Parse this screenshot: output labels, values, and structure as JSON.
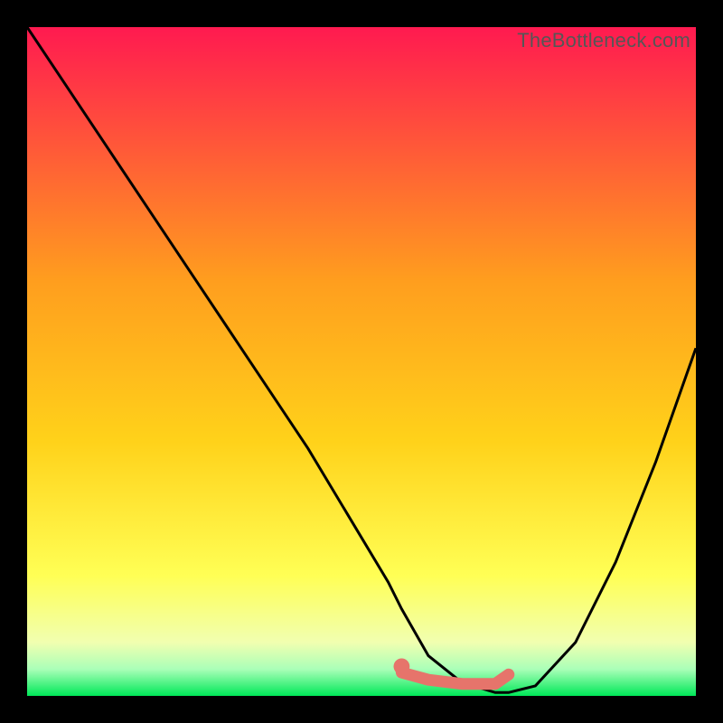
{
  "watermark": {
    "text": "TheBottleneck.com"
  },
  "colors": {
    "gradient_top": "#ff1a50",
    "gradient_mid": "#ffd21a",
    "gradient_low": "#ffff8a",
    "gradient_base": "#00e858",
    "curve": "#000000",
    "marker": "#e6746b",
    "frame": "#000000"
  },
  "chart_data": {
    "type": "line",
    "title": "",
    "xlabel": "",
    "ylabel": "",
    "xlim": [
      0,
      100
    ],
    "ylim": [
      0,
      100
    ],
    "grid": false,
    "legend": false,
    "series": [
      {
        "name": "curve",
        "x": [
          0,
          6,
          12,
          18,
          24,
          30,
          36,
          42,
          48,
          54,
          56,
          60,
          65,
          70,
          72,
          76,
          82,
          88,
          94,
          100
        ],
        "y": [
          100,
          91,
          82,
          73,
          64,
          55,
          46,
          37,
          27,
          17,
          13,
          6,
          2,
          0.5,
          0.5,
          1.5,
          8,
          20,
          35,
          52
        ]
      }
    ],
    "marker_segment": {
      "x": [
        56,
        60,
        65,
        70,
        72
      ],
      "y": [
        3.5,
        2.4,
        1.8,
        1.8,
        3.2
      ]
    },
    "marker_start_dot": {
      "x": 56,
      "y": 4.4,
      "r": 1.2
    }
  }
}
